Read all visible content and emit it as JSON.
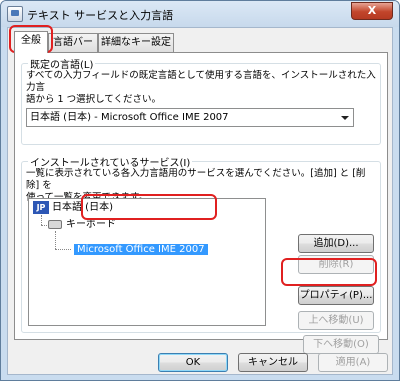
{
  "window": {
    "title": "テキスト サービスと入力言語",
    "close_label": "X"
  },
  "tabs": [
    {
      "label": "全般",
      "active": true
    },
    {
      "label": "言語バー",
      "active": false
    },
    {
      "label": "詳細なキー設定",
      "active": false
    }
  ],
  "default_language": {
    "group_label": "既定の言語(L)",
    "description_line1": "すべての入力フィールドの既定言語として使用する言語を、インストールされた入力言",
    "description_line2": "語から 1 つ選択してください。",
    "selected_value": "日本語 (日本) - Microsoft Office IME 2007"
  },
  "installed_services": {
    "group_label": "インストールされているサービス(I)",
    "description_line1": "一覧に表示されている各入力言語用のサービスを選んでください。[追加] と [削除] を",
    "description_line2": "使って一覧を変更できます。",
    "tree": {
      "language_icon": "JP",
      "language": "日本語 (日本)",
      "category": "キーボード",
      "service": "Microsoft Office IME 2007"
    },
    "buttons": {
      "add": "追加(D)...",
      "remove": "削除(R)",
      "properties": "プロパティ(P)...",
      "move_up": "上へ移動(U)",
      "move_down": "下へ移動(O)"
    }
  },
  "footer": {
    "ok": "OK",
    "cancel": "キャンセル",
    "apply": "適用(A)"
  },
  "colors": {
    "highlight": "#e02020",
    "selection": "#3399ff"
  }
}
